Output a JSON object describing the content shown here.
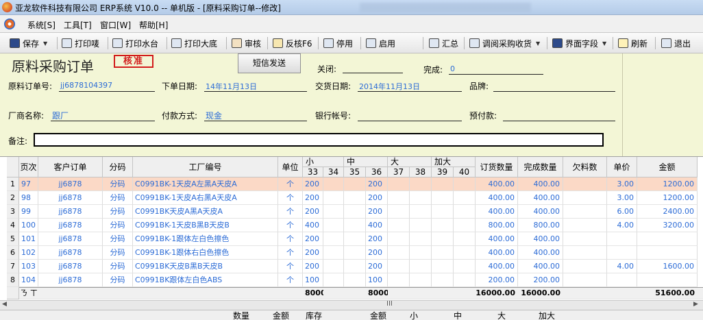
{
  "window": {
    "title": "亚龙软件科技有限公司 ERP系统 V10.0 -- 单机版 - [原料采购订单--修改]"
  },
  "menu": {
    "items": [
      "系统[S]",
      "工具[T]",
      "窗口[W]",
      "帮助[H]"
    ]
  },
  "toolbar": {
    "save": "保存",
    "print_label": "打印唛",
    "print_watermark": "打印水台",
    "print_base": "打印大底",
    "review": "审核",
    "unreview": "反核F6",
    "disable": "停用",
    "enable": "启用",
    "summary": "汇总",
    "purchase_receipt": "调阅采购收货",
    "ui_fields": "界面字段",
    "refresh": "刷新",
    "exit": "退出"
  },
  "form": {
    "page_title": "原料采购订单",
    "approval_stamp": "核准",
    "sms_button": "短信发送",
    "close_label": "关闭:",
    "close_value": "",
    "complete_label": "完成:",
    "complete_value": "0",
    "order_no_label": "原料订单号:",
    "order_no": "jj6878104397",
    "order_date_label": "下单日期:",
    "order_date": "14年11月13日",
    "delivery_date_label": "交货日期:",
    "delivery_date": "2014年11月13日",
    "brand_label": "品牌:",
    "brand": "",
    "vendor_label": "厂商名称:",
    "vendor": "跟厂",
    "payment_label": "付款方式:",
    "payment": "现金",
    "bank_label": "银行帐号:",
    "bank": "",
    "prepay_label": "预付款:",
    "prepay": "",
    "remark_label": "备注:",
    "remark": ""
  },
  "grid": {
    "headers": {
      "page": "页次",
      "customer_order": "客户订单",
      "code": "分码",
      "factory_no": "工厂编号",
      "unit": "单位",
      "small": "小",
      "medium": "中",
      "large": "大",
      "xlarge": "加大",
      "sizes": [
        "33",
        "34",
        "35",
        "36",
        "37",
        "38",
        "39",
        "40"
      ],
      "order_qty": "订货数量",
      "done_qty": "完成数量",
      "short_qty": "欠料数",
      "price": "单价",
      "amount": "金额"
    },
    "rows": [
      {
        "n": "1",
        "page": "97",
        "cust": "jj6878",
        "code": "分码",
        "factory": "C0991BK-1天皮A左黑A天皮A",
        "unit": "个",
        "s33": "200",
        "s36": "200",
        "order": "400.00",
        "done": "400.00",
        "short": "",
        "price": "3.00",
        "amount": "1200.00"
      },
      {
        "n": "2",
        "page": "98",
        "cust": "jj6878",
        "code": "分码",
        "factory": "C0991BK-1天皮A右黑A天皮A",
        "unit": "个",
        "s33": "200",
        "s36": "200",
        "order": "400.00",
        "done": "400.00",
        "short": "",
        "price": "3.00",
        "amount": "1200.00"
      },
      {
        "n": "3",
        "page": "99",
        "cust": "jj6878",
        "code": "分码",
        "factory": "C0991BK天皮A黑A天皮A",
        "unit": "个",
        "s33": "200",
        "s36": "200",
        "order": "400.00",
        "done": "400.00",
        "short": "",
        "price": "6.00",
        "amount": "2400.00"
      },
      {
        "n": "4",
        "page": "100",
        "cust": "jj6878",
        "code": "分码",
        "factory": "C0991BK-1天皮B黑B天皮B",
        "unit": "个",
        "s33": "400",
        "s36": "400",
        "order": "800.00",
        "done": "800.00",
        "short": "",
        "price": "4.00",
        "amount": "3200.00"
      },
      {
        "n": "5",
        "page": "101",
        "cust": "jj6878",
        "code": "分码",
        "factory": "C0991BK-1跟体左白色擦色",
        "unit": "个",
        "s33": "200",
        "s36": "200",
        "order": "400.00",
        "done": "400.00",
        "short": "",
        "price": "",
        "amount": ""
      },
      {
        "n": "6",
        "page": "102",
        "cust": "jj6878",
        "code": "分码",
        "factory": "C0991BK-1跟体右白色擦色",
        "unit": "个",
        "s33": "200",
        "s36": "200",
        "order": "400.00",
        "done": "400.00",
        "short": "",
        "price": "",
        "amount": ""
      },
      {
        "n": "7",
        "page": "103",
        "cust": "jj6878",
        "code": "分码",
        "factory": "C0991BK天皮B黑B天皮B",
        "unit": "个",
        "s33": "200",
        "s36": "200",
        "order": "400.00",
        "done": "400.00",
        "short": "",
        "price": "4.00",
        "amount": "1600.00"
      },
      {
        "n": "8",
        "page": "104",
        "cust": "jj6878",
        "code": "分码",
        "factory": "C0991BK跟体左白色ABS",
        "unit": "个",
        "s33": "100",
        "s36": "100",
        "order": "200.00",
        "done": "200.00",
        "short": "",
        "price": "",
        "amount": ""
      }
    ],
    "footer": {
      "label": "ㄋ ㄒ",
      "s33": "8000",
      "s36": "8000",
      "order": "16000.00",
      "done": "16000.00",
      "amount": "51600.00"
    },
    "scroll_marker": "III"
  },
  "bottom_headers": [
    "数量",
    "金额",
    "库存",
    "金额",
    "小",
    "中",
    "大",
    "加大"
  ],
  "colors": {
    "form_bg": "#f3f6d6",
    "selected_row": "#fbd9c6",
    "link_blue": "#2b6bd6",
    "stamp_red": "#d21c1c"
  }
}
